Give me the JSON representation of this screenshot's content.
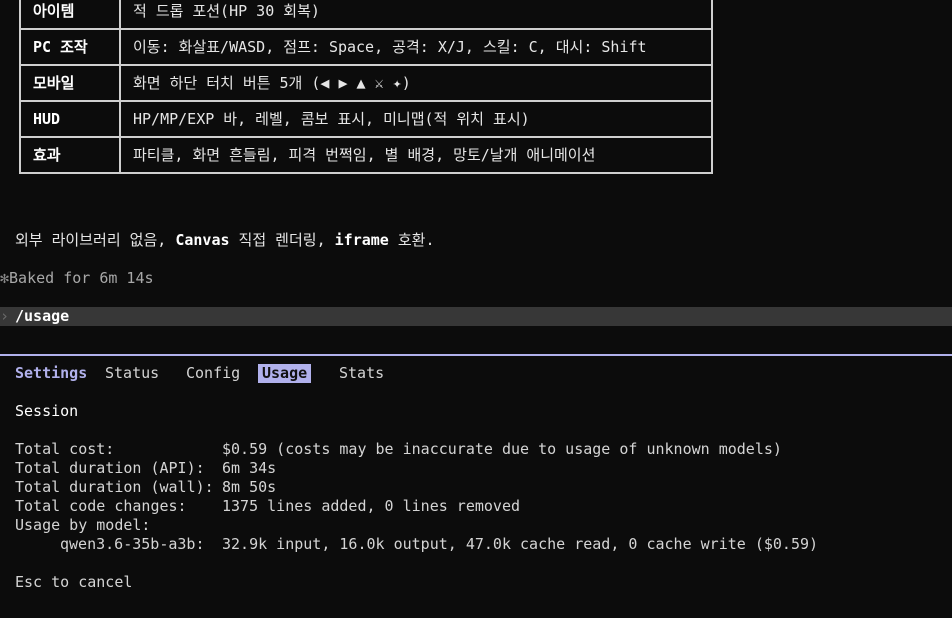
{
  "feature_table": [
    {
      "key": "아이템",
      "value": "적 드롭 포션(HP 30 회복)"
    },
    {
      "key": "PC 조작",
      "value": "이동: 화살표/WASD, 점프: Space, 공격: X/J, 스킬: C, 대시: Shift"
    },
    {
      "key": "모바일",
      "value": "화면 하단 터치 버튼 5개 (◀ ▶ ▲ ⚔ ✦)"
    },
    {
      "key": "HUD",
      "value": "HP/MP/EXP 바, 레벨, 콤보 표시, 미니맵(적 위치 표시)"
    },
    {
      "key": "효과",
      "value": "파티클, 화면 흔들림, 피격 번쩍임, 별 배경, 망토/날개 애니메이션"
    }
  ],
  "note": {
    "part1": "외부 라이브러리 없음, ",
    "canvas": "Canvas",
    "part2": " 직접 렌더링, ",
    "iframe": "iframe",
    "part3": " 호환."
  },
  "baked": {
    "glyph": "✻",
    "text": "Baked for 6m 14s"
  },
  "prompt": {
    "chevron": "›",
    "command": "/usage"
  },
  "tabs": {
    "title": "Settings",
    "status": "Status",
    "config": "Config",
    "usage": "Usage",
    "stats": "Stats"
  },
  "session": {
    "title": "Session",
    "rows": [
      {
        "label": "Total cost:",
        "value": "$0.59 (costs may be inaccurate due to usage of unknown models)"
      },
      {
        "label": "Total duration (API):",
        "value": "6m 34s"
      },
      {
        "label": "Total duration (wall):",
        "value": "8m 50s"
      },
      {
        "label": "Total code changes:",
        "value": "1375 lines added, 0 lines removed"
      }
    ],
    "by_model_label": "Usage by model:",
    "model_name": "qwen3.6-35b-a3b:",
    "model_usage": "32.9k input, 16.0k output, 47.0k cache read, 0 cache write ($0.59)"
  },
  "footer": {
    "esc_hint": "Esc to cancel"
  },
  "colors": {
    "accent": "#b1b1ec",
    "background": "#0c0c0c",
    "prompt_bar": "#373737"
  }
}
